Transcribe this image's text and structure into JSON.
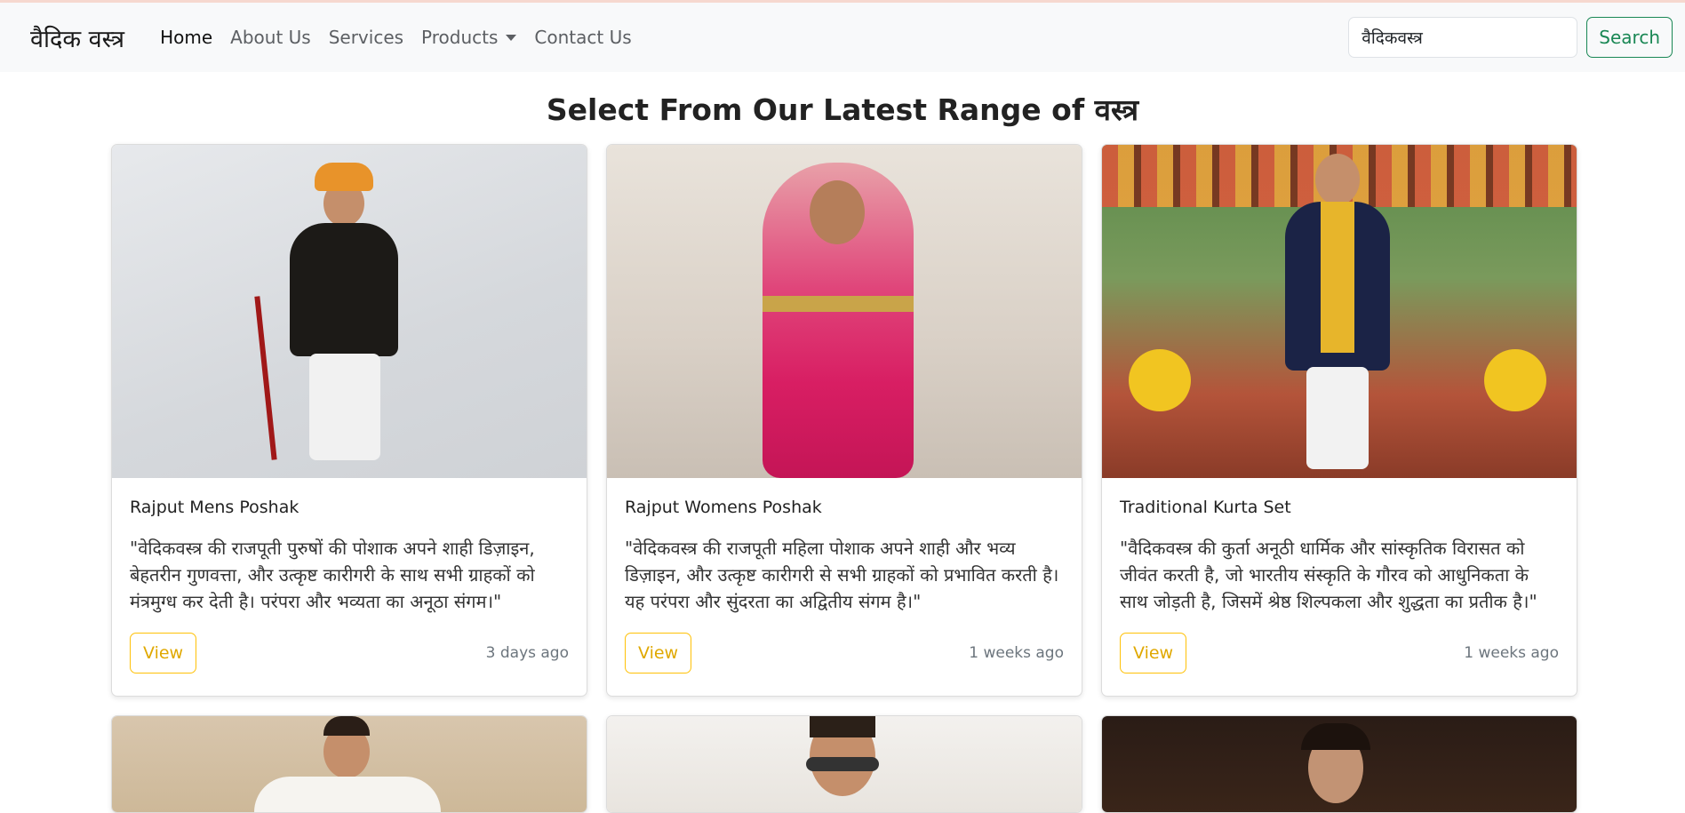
{
  "navbar": {
    "brand": "वैदिक वस्त्र",
    "links": [
      {
        "label": "Home",
        "active": true
      },
      {
        "label": "About Us"
      },
      {
        "label": "Services"
      },
      {
        "label": "Products",
        "dropdown": true
      },
      {
        "label": "Contact Us"
      }
    ],
    "search_value": "वैदिकवस्त्र",
    "search_button": "Search"
  },
  "heading": "Select From Our Latest Range of वस्त्र",
  "cards": [
    {
      "title": "Rajput Mens Poshak",
      "text": "\"वेदिकवस्त्र की राजपूती पुरुषों की पोशाक अपने शाही डिज़ाइन, बेहतरीन गुणवत्ता, और उत्कृष्ट कारीगरी के साथ सभी ग्राहकों को मंत्रमुग्ध कर देती है। परंपरा और भव्यता का अनूठा संगम।\"",
      "button": "View",
      "time": "3 days ago",
      "image": "man-in-black-sherwani-with-orange-turban"
    },
    {
      "title": "Rajput Womens Poshak",
      "text": "\"वेदिकवस्त्र की राजपूती महिला पोशाक अपने शाही और भव्य डिज़ाइन, और उत्कृष्ट कारीगरी से सभी ग्राहकों को प्रभावित करती है। यह परंपरा और सुंदरता का अद्वितीय संगम है।\"",
      "button": "View",
      "time": "1 weeks ago",
      "image": "woman-in-pink-rajputi-poshak"
    },
    {
      "title": "Traditional Kurta Set",
      "text": "\"वैदिकवस्त्र की कुर्ता अनूठी धार्मिक और सांस्कृतिक विरासत को जीवंत करती है, जो भारतीय संस्कृति के गौरव को आधुनिकता के साथ जोड़ती है, जिसमें श्रेष्ठ शिल्पकला और शुद्धता का प्रतीक है।\"",
      "button": "View",
      "time": "1 weeks ago",
      "image": "man-in-navy-kurta-with-yellow-dupatta"
    },
    {
      "image": "man-in-white-outfit"
    },
    {
      "image": "man-with-sunglasses"
    },
    {
      "image": "woman-with-jhumka-earrings"
    }
  ]
}
